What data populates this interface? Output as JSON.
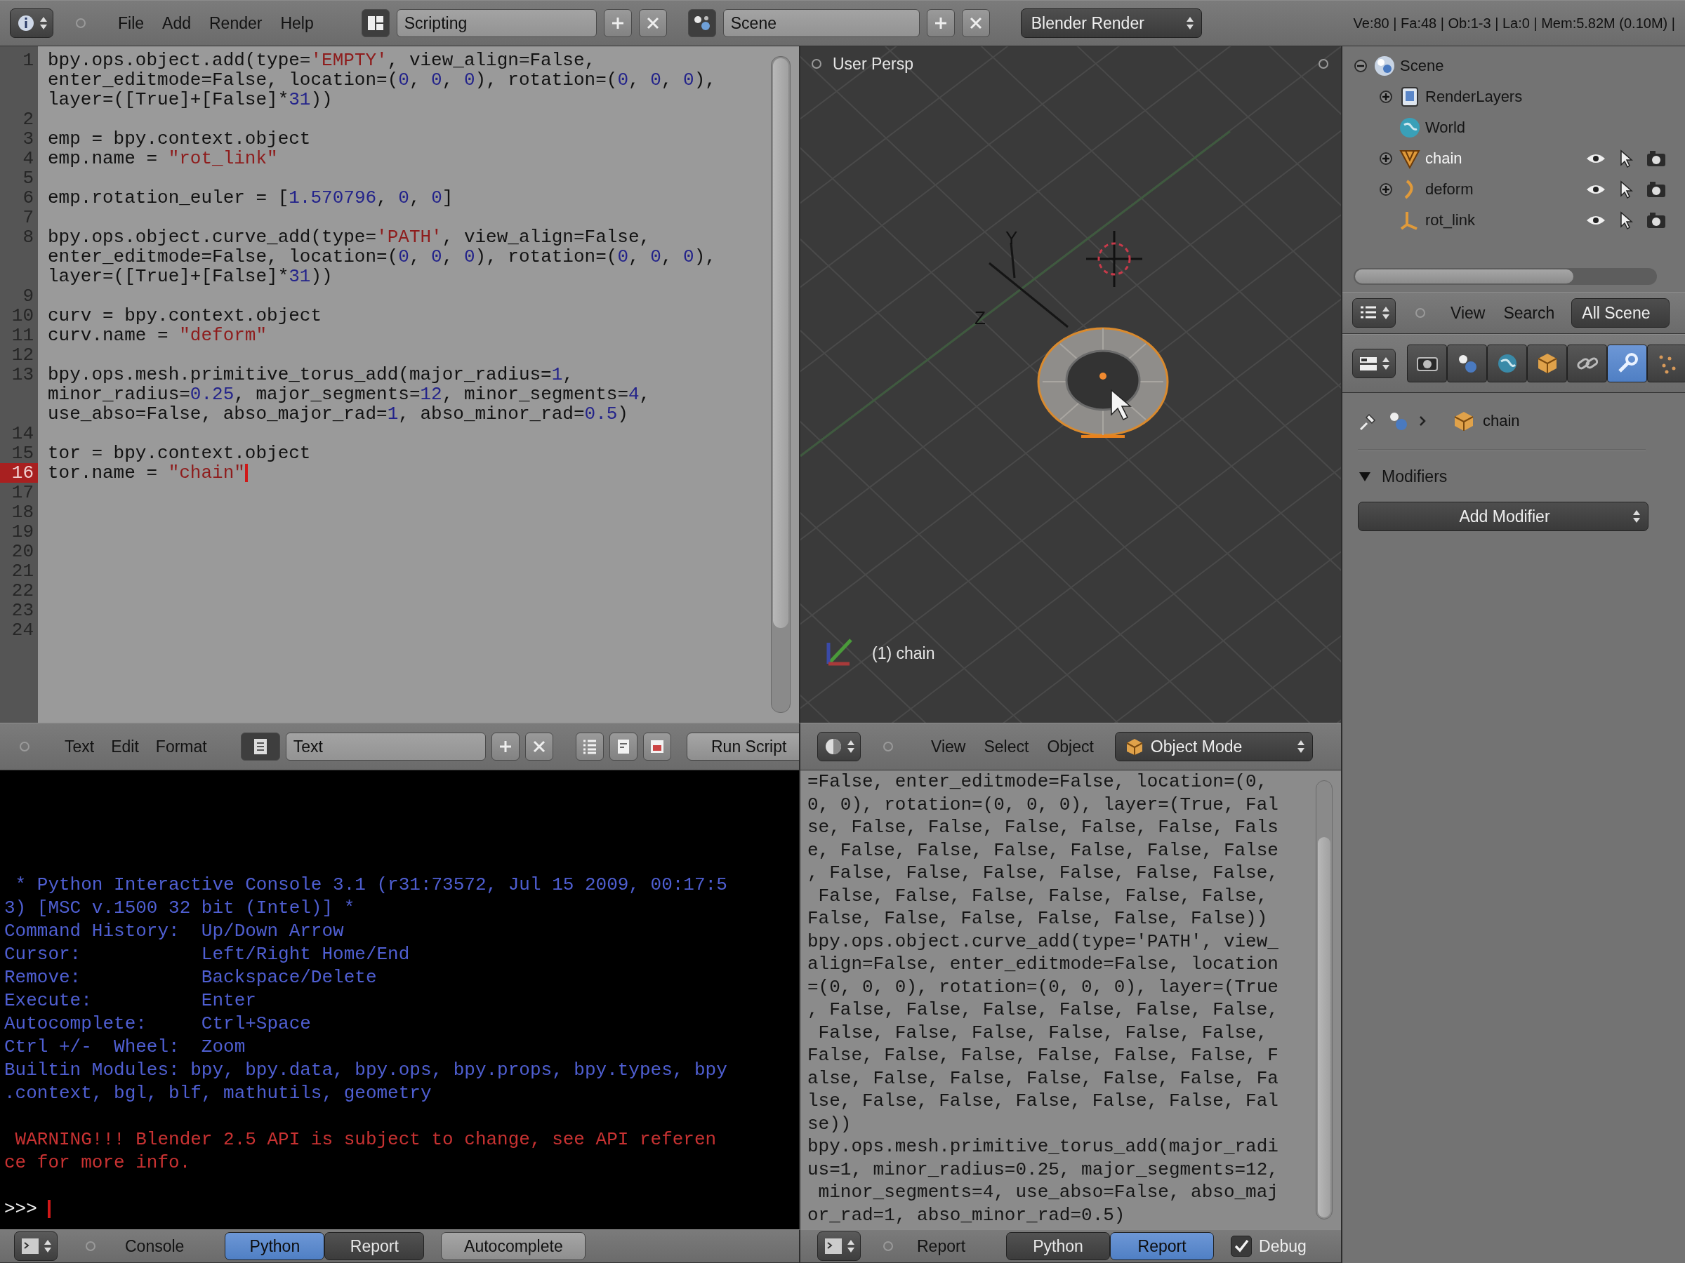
{
  "top_bar": {
    "menus": [
      "File",
      "Add",
      "Render",
      "Help"
    ],
    "layout": "Scripting",
    "scene": "Scene",
    "render_engine": "Blender Render",
    "stats": "Ve:80 | Fa:48 | Ob:1-3 | La:0 | Mem:5.82M (0.10M) |"
  },
  "text_editor": {
    "lines": [
      {
        "number": "1",
        "current": false,
        "rows": [
          "bpy.ops.object.add(type='EMPTY', view_align=False,",
          "enter_editmode=False, location=(0, 0, 0), rotation=(0, 0, 0),",
          "layer=([True]+[False]*31))"
        ]
      },
      {
        "number": "2",
        "current": false
      },
      {
        "number": "3",
        "current": false,
        "rows": [
          "emp = bpy.context.object"
        ]
      },
      {
        "number": "4",
        "current": false,
        "rows": [
          "emp.name = \"rot_link\""
        ]
      },
      {
        "number": "5",
        "current": false
      },
      {
        "number": "6",
        "current": false,
        "rows": [
          "emp.rotation_euler = [1.570796, 0, 0]"
        ]
      },
      {
        "number": "7",
        "current": false
      },
      {
        "number": "8",
        "current": false,
        "rows": [
          "bpy.ops.object.curve_add(type='PATH', view_align=False,",
          "enter_editmode=False, location=(0, 0, 0), rotation=(0, 0, 0),",
          "layer=([True]+[False]*31))"
        ]
      },
      {
        "number": "9",
        "current": false
      },
      {
        "number": "10",
        "current": false,
        "rows": [
          "curv = bpy.context.object"
        ]
      },
      {
        "number": "11",
        "current": false,
        "rows": [
          "curv.name = \"deform\""
        ]
      },
      {
        "number": "12",
        "current": false
      },
      {
        "number": "13",
        "current": false,
        "rows": [
          "bpy.ops.mesh.primitive_torus_add(major_radius=1,",
          "minor_radius=0.25, major_segments=12, minor_segments=4,",
          "use_abso=False, abso_major_rad=1, abso_minor_rad=0.5)"
        ]
      },
      {
        "number": "14",
        "current": false
      },
      {
        "number": "15",
        "current": false,
        "rows": [
          "tor = bpy.context.object"
        ]
      },
      {
        "number": "16",
        "current": true,
        "rows": [
          "tor.name = \"chain\""
        ]
      },
      {
        "number": "17",
        "current": false
      },
      {
        "number": "18",
        "current": false
      },
      {
        "number": "19",
        "current": false
      },
      {
        "number": "20",
        "current": false
      },
      {
        "number": "21",
        "current": false
      },
      {
        "number": "22",
        "current": false
      },
      {
        "number": "23",
        "current": false
      },
      {
        "number": "24",
        "current": false
      }
    ],
    "header": {
      "menus": [
        "Text",
        "Edit",
        "Format"
      ],
      "datablock": "Text",
      "run_button": "Run Script"
    }
  },
  "viewport": {
    "view_label": "User Persp",
    "axis_labels": [
      "Y",
      "Z"
    ],
    "object_label": "(1) chain",
    "header": {
      "menus": [
        "View",
        "Select",
        "Object"
      ],
      "mode": "Object Mode"
    }
  },
  "console": {
    "lines": [
      {
        "kind": "info",
        "text": " * Python Interactive Console 3.1 (r31:73572, Jul 15 2009, 00:17:5"
      },
      {
        "kind": "info",
        "text": "3) [MSC v.1500 32 bit (Intel)] *"
      },
      {
        "kind": "info",
        "text": "Command History:  Up/Down Arrow"
      },
      {
        "kind": "info",
        "text": "Cursor:           Left/Right Home/End"
      },
      {
        "kind": "info",
        "text": "Remove:           Backspace/Delete"
      },
      {
        "kind": "info",
        "text": "Execute:          Enter"
      },
      {
        "kind": "info",
        "text": "Autocomplete:     Ctrl+Space"
      },
      {
        "kind": "info",
        "text": "Ctrl +/-  Wheel:  Zoom"
      },
      {
        "kind": "info",
        "text": "Builtin Modules: bpy, bpy.data, bpy.ops, bpy.props, bpy.types, bpy"
      },
      {
        "kind": "info",
        "text": ".context, bgl, blf, mathutils, geometry"
      },
      {
        "kind": "blank"
      },
      {
        "kind": "warning",
        "text": " WARNING!!! Blender 2.5 API is subject to change, see API referen"
      },
      {
        "kind": "warning",
        "text": "ce for more info."
      },
      {
        "kind": "blank"
      }
    ],
    "prompt": ">>>",
    "header": {
      "menus": [
        "Console"
      ],
      "modes": [
        {
          "label": "Python",
          "selected": true
        },
        {
          "label": "Report",
          "selected": false
        }
      ],
      "autocomplete": "Autocomplete"
    }
  },
  "report": {
    "lines": [
      "=False, enter_editmode=False, location=(0,",
      "0, 0), rotation=(0, 0, 0), layer=(True, Fal",
      "se, False, False, False, False, False, Fals",
      "e, False, False, False, False, False, False",
      ", False, False, False, False, False, False,",
      " False, False, False, False, False, False,",
      "False, False, False, False, False, False))",
      "bpy.ops.object.curve_add(type='PATH', view_",
      "align=False, enter_editmode=False, location",
      "=(0, 0, 0), rotation=(0, 0, 0), layer=(True",
      ", False, False, False, False, False, False,",
      " False, False, False, False, False, False,",
      "False, False, False, False, False, False, F",
      "alse, False, False, False, False, False, Fa",
      "lse, False, False, False, False, False, Fal",
      "se))",
      "bpy.ops.mesh.primitive_torus_add(major_radi",
      "us=1, minor_radius=0.25, major_segments=12,",
      " minor_segments=4, use_abso=False, abso_maj",
      "or_rad=1, abso_minor_rad=0.5)"
    ],
    "header": {
      "menus": [
        "Report"
      ],
      "filters": [
        {
          "label": "Python",
          "selected": false
        },
        {
          "label": "Report",
          "selected": true
        }
      ],
      "debug": {
        "label": "Debug",
        "checked": true
      }
    }
  },
  "outliner": {
    "tree": [
      {
        "label": "Scene",
        "kind": "scene",
        "expanded": true,
        "selected": false,
        "children": [
          {
            "label": "RenderLayers",
            "kind": "render_layers",
            "expanded": false,
            "selected": false
          },
          {
            "label": "World",
            "kind": "world",
            "selected": false
          },
          {
            "label": "chain",
            "kind": "mesh",
            "expanded": false,
            "selected": true
          },
          {
            "label": "deform",
            "kind": "curve",
            "expanded": false,
            "selected": false
          },
          {
            "label": "rot_link",
            "kind": "empty",
            "selected": false
          }
        ]
      }
    ],
    "header": {
      "menus": [
        "View",
        "Search"
      ],
      "display": "All Scene"
    }
  },
  "properties": {
    "tabs": [
      {
        "kind": "render",
        "selected": false
      },
      {
        "kind": "scene",
        "selected": false
      },
      {
        "kind": "world",
        "selected": false
      },
      {
        "kind": "object",
        "selected": false
      },
      {
        "kind": "constraints",
        "selected": false
      },
      {
        "kind": "modifiers",
        "selected": true
      },
      {
        "kind": "particles",
        "selected": false
      }
    ],
    "breadcrumb": {
      "object": "chain"
    },
    "panel": {
      "title": "Modifiers",
      "expanded": true,
      "button": "Add Modifier"
    }
  }
}
